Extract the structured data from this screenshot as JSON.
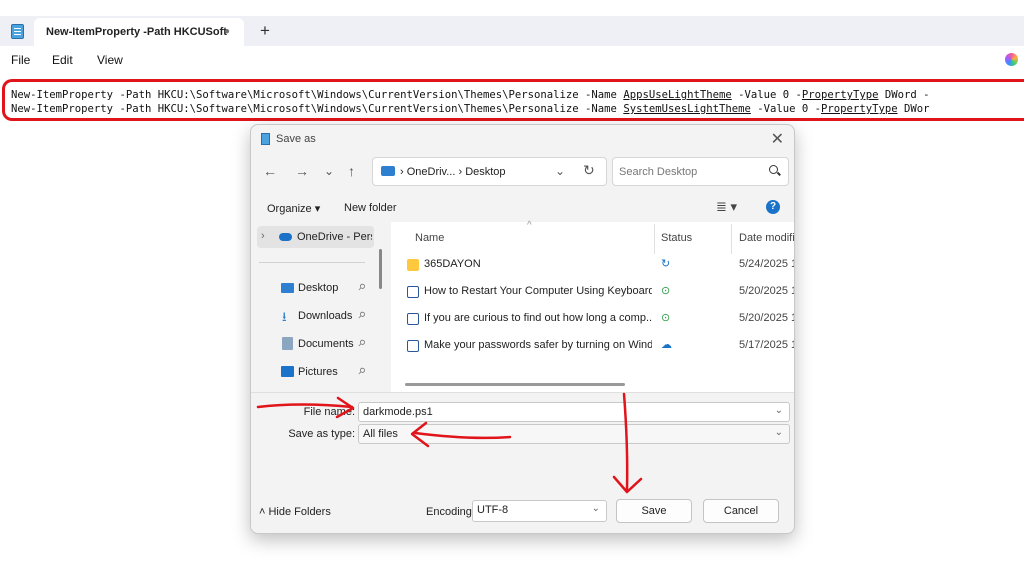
{
  "window": {
    "tab_title": "New-ItemProperty -Path HKCUSoft",
    "tab_dot": "●",
    "new_tab": "+"
  },
  "menu": {
    "file": "File",
    "edit": "Edit",
    "view": "View"
  },
  "editor": {
    "lines": [
      {
        "cmd": "New-ItemProperty",
        "path": " -Path HKCU:\\Software\\Microsoft\\Windows\\CurrentVersion\\Themes\\Personalize -Name ",
        "name": "AppsUseLightTheme",
        "mid": " -Value 0 -",
        "ptype": "PropertyType",
        "tail": " DWord -"
      },
      {
        "cmd": "New-ItemProperty",
        "path": " -Path HKCU:\\Software\\Microsoft\\Windows\\CurrentVersion\\Themes\\Personalize -Name ",
        "name": "SystemUsesLightTheme",
        "mid": " -Value 0 -",
        "ptype": "PropertyType",
        "tail": " DWor"
      }
    ]
  },
  "dialog": {
    "title": "Save as",
    "close": "✕",
    "nav": {
      "back": "←",
      "forward": "→",
      "recent": "⌄",
      "up": "↑"
    },
    "address": "› OneDriv... › Desktop",
    "address_chev": "⌄",
    "refresh": "↻",
    "search_placeholder": "Search Desktop",
    "organize": "Organize ▾",
    "new_folder": "New folder",
    "view_toggle": "≣ ▾",
    "help": "?",
    "nav_pane": {
      "onedrive": "OneDrive - Perso",
      "expand": "›",
      "items": [
        "Desktop",
        "Downloads",
        "Documents",
        "Pictures"
      ],
      "pin": "📌"
    },
    "columns": {
      "name": "Name",
      "status": "Status",
      "date": "Date modifi",
      "sort_caret": "^"
    },
    "files": [
      {
        "name": "365DAYON",
        "status": "↻",
        "status_color": "#1a73c9",
        "date": "5/24/2025 1",
        "type": "folder"
      },
      {
        "name": "How to Restart Your Computer Using Keyboard...",
        "status": "⊙",
        "status_color": "#2e9e48",
        "date": "5/20/2025 1",
        "type": "doc"
      },
      {
        "name": "If you are curious to find out how long a comp...",
        "status": "⊙",
        "status_color": "#2e9e48",
        "date": "5/20/2025 1",
        "type": "doc"
      },
      {
        "name": "Make your passwords safer by turning on Wind...",
        "status": "☁",
        "status_color": "#1a73c9",
        "date": "5/17/2025 1",
        "type": "doc"
      }
    ],
    "file_name_label": "File name:",
    "file_name_value": "darkmode.ps1",
    "save_type_label": "Save as type:",
    "save_type_value": "All files",
    "field_chev": "⌄",
    "hide_folders": "˄ Hide Folders",
    "encoding_label": "Encoding:",
    "encoding_value": "UTF-8",
    "save": "Save",
    "cancel": "Cancel"
  },
  "colors": {
    "annotation_red": "#e0141a",
    "accent": "#1a73c9",
    "folder": "#ffc83d"
  }
}
